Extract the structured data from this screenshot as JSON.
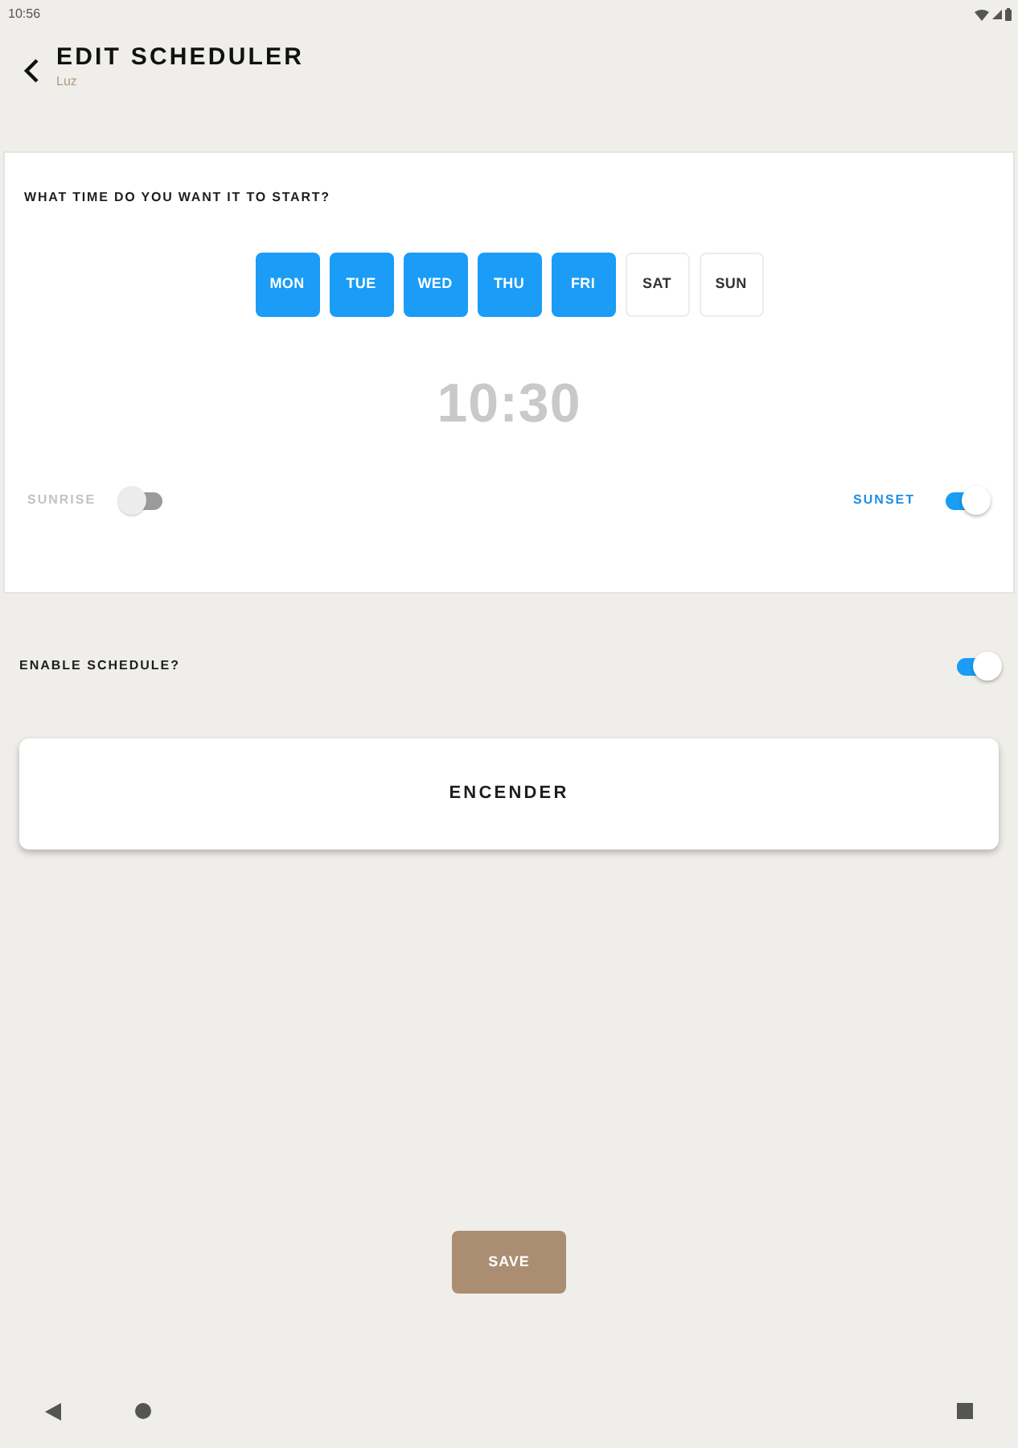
{
  "status_bar": {
    "time": "10:56"
  },
  "header": {
    "title": "EDIT SCHEDULER",
    "subtitle": "Luz"
  },
  "start_card": {
    "question": "WHAT TIME DO YOU WANT IT TO START?",
    "days": [
      {
        "label": "MON",
        "selected": true
      },
      {
        "label": "TUE",
        "selected": true
      },
      {
        "label": "WED",
        "selected": true
      },
      {
        "label": "THU",
        "selected": true
      },
      {
        "label": "FRI",
        "selected": true
      },
      {
        "label": "SAT",
        "selected": false
      },
      {
        "label": "SUN",
        "selected": false
      }
    ],
    "time": "10:30",
    "options": [
      {
        "label": "SUNRISE",
        "on": false
      },
      {
        "label": "SUNSET",
        "on": true
      }
    ]
  },
  "enable_schedule": {
    "label": "ENABLE SCHEDULE?",
    "on": true
  },
  "action_card": {
    "label": "ENCENDER"
  },
  "save_button": {
    "label": "SAVE"
  }
}
